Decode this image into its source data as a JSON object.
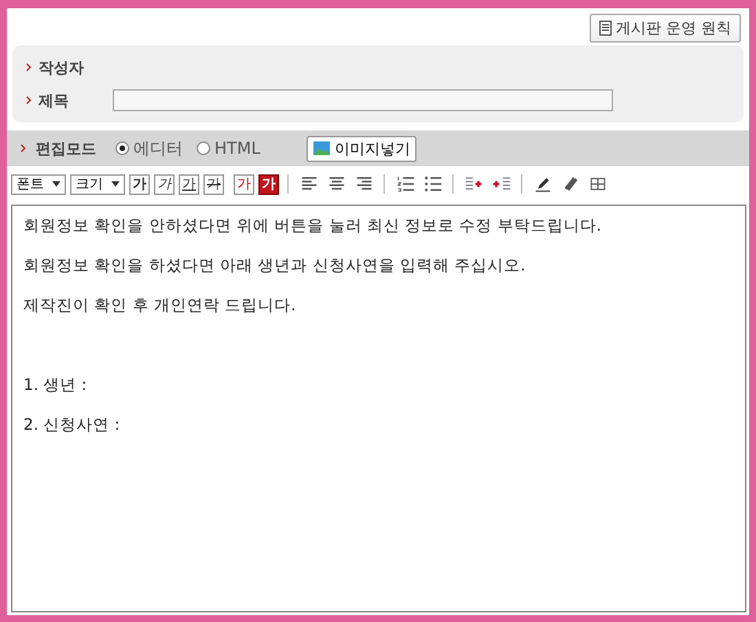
{
  "rules_button": {
    "label": "게시판 운영 원칙"
  },
  "form": {
    "author_label": "작성자",
    "title_label": "제목"
  },
  "edit_mode": {
    "label": "편집모드",
    "options": [
      {
        "label": "에디터",
        "selected": true
      },
      {
        "label": "HTML",
        "selected": false
      }
    ],
    "image_button": "이미지넣기"
  },
  "toolbar": {
    "dropdowns": [
      {
        "label": "폰트"
      },
      {
        "label": "크기"
      }
    ],
    "format_buttons": [
      {
        "kind": "bold",
        "label": "가"
      },
      {
        "kind": "italic",
        "label": "가"
      },
      {
        "kind": "underline",
        "label": "가"
      },
      {
        "kind": "strike",
        "label": "가"
      },
      {
        "kind": "color",
        "label": "가"
      },
      {
        "kind": "highlight",
        "label": "가"
      }
    ]
  },
  "editor": {
    "blocks": [
      [
        "회원정보 확인을 안하셨다면 위에 버튼을 눌러 최신 정보로 수정 부탁드립니다.",
        "회원정보 확인을 하셨다면 아래 생년과 신청사연을 입력해 주십시오.",
        "제작진이 확인 후 개인연락 드립니다."
      ],
      [
        "1. 생년 :",
        "2. 신청사연 :"
      ]
    ]
  }
}
